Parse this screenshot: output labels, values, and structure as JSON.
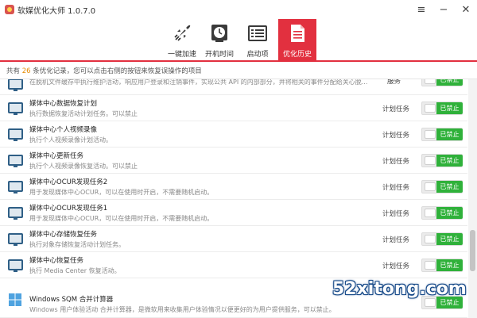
{
  "window": {
    "title": "软媒优化大师 1.0.7.0",
    "menu_glyph": "≡",
    "minimize_glyph": "−",
    "close_glyph": "✕"
  },
  "toolbar": {
    "tabs": [
      {
        "label": "一键加速",
        "icon": "rocket-icon"
      },
      {
        "label": "开机时间",
        "icon": "clock-icon"
      },
      {
        "label": "启动项",
        "icon": "startup-list-icon"
      },
      {
        "label": "优化历史",
        "icon": "history-document-icon",
        "active": true
      }
    ]
  },
  "notice": {
    "prefix": "共有",
    "count": "26",
    "suffix": "条优化记录，您可以点击右侧的按钮来恢复误操作的项目"
  },
  "list": {
    "items": [
      {
        "name": "",
        "desc": "在脱机文件缓存中执行维护活动，响应用户登录和注销事件，实现公共 API 的内部部分，并将相关的事件分配给关心脱...",
        "type": "服务",
        "status": "已禁止"
      },
      {
        "name": "媒体中心数据恢复计划",
        "desc": "执行数据恢复活动计划任务。可以禁止",
        "type": "计划任务",
        "status": "已禁止"
      },
      {
        "name": "媒体中心个人视频录像",
        "desc": "执行个人视频录像计划活动。",
        "type": "计划任务",
        "status": "已禁止"
      },
      {
        "name": "媒体中心更新任务",
        "desc": "执行个人视频录像恢复活动。可以禁止",
        "type": "计划任务",
        "status": "已禁止"
      },
      {
        "name": "媒体中心OCUR发现任务2",
        "desc": "用于发现媒体中心OCUR，可以在使用时开启，不需要随机启动。",
        "type": "计划任务",
        "status": "已禁止"
      },
      {
        "name": "媒体中心OCUR发现任务1",
        "desc": "用于发现媒体中心OCUR，可以在使用时开启，不需要随机启动。",
        "type": "计划任务",
        "status": "已禁止"
      },
      {
        "name": "媒体中心存储恢复任务",
        "desc": "执行对象存储恢复活动计划任务。",
        "type": "计划任务",
        "status": "已禁止"
      },
      {
        "name": "媒体中心恢复任务",
        "desc": "执行 Media Center 恢复活动。",
        "type": "计划任务",
        "status": "已禁止"
      },
      {
        "name": "Windows SQM 合并计算器",
        "desc": "Windows 用户体验活动 合并计算器，是微软用来收集用户体验情况以便更好的为用户提供服务，可以禁止。",
        "type": "",
        "status": "已禁止"
      }
    ]
  },
  "watermark": "52xitong.com",
  "colors": {
    "accent": "#e2303f",
    "toggle_green": "#2fb13a",
    "count_orange": "#e58a00"
  }
}
